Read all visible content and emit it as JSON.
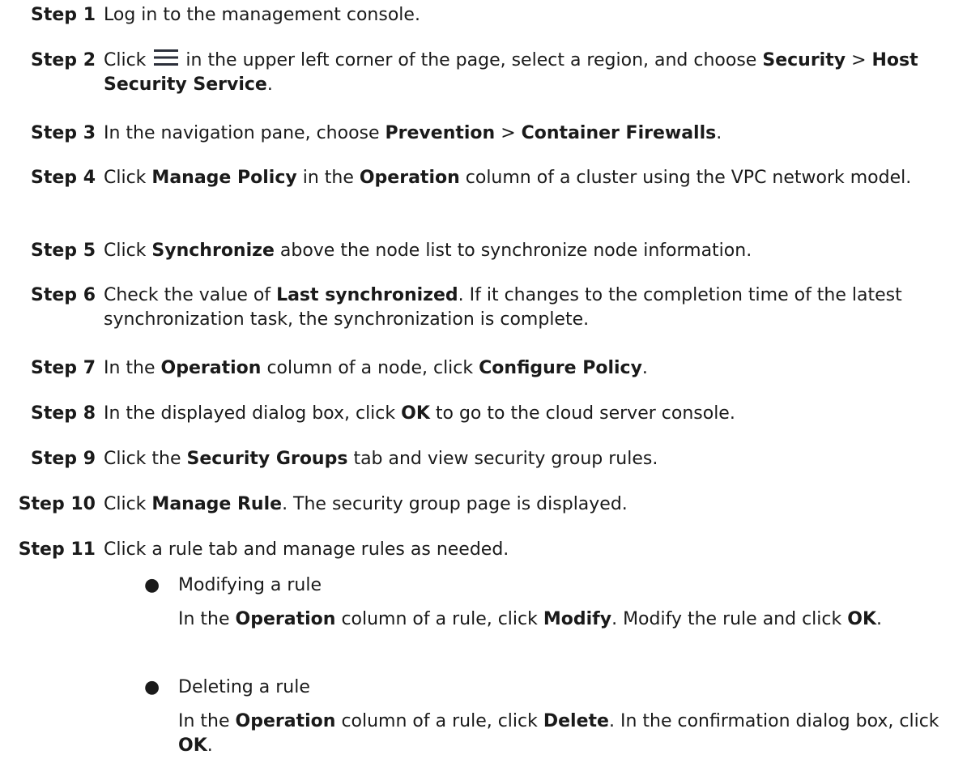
{
  "steps": {
    "s1": {
      "label": "Step 1",
      "text": "Log in to the management console."
    },
    "s2": {
      "label": "Step 2",
      "t1": "Click",
      "t2": "in the upper left corner of the page, select a region, and choose",
      "b1": "Security",
      "t3": ">",
      "b2": "Host Security Service",
      "t4": "."
    },
    "s3": {
      "label": "Step 3",
      "t1": "In the navigation pane, choose",
      "b1": "Prevention",
      "t2": ">",
      "b2": "Container Firewalls",
      "t3": "."
    },
    "s4": {
      "label": "Step 4",
      "t1": "Click",
      "b1": "Manage Policy",
      "t2": "in the",
      "b2": "Operation",
      "t3": "column of a cluster using the VPC network model."
    },
    "s5": {
      "label": "Step 5",
      "t1": "Click",
      "b1": "Synchronize",
      "t2": "above the node list to synchronize node information."
    },
    "s6": {
      "label": "Step 6",
      "t1": "Check the value of",
      "b1": "Last synchronized",
      "t2": ". If it changes to the completion time of the latest synchronization task, the synchronization is complete."
    },
    "s7": {
      "label": "Step 7",
      "t1": "In the",
      "b1": "Operation",
      "t2": "column of a node, click",
      "b2": "Configure Policy",
      "t3": "."
    },
    "s8": {
      "label": "Step 8",
      "t1": "In the displayed dialog box, click",
      "b1": "OK",
      "t2": "to go to the cloud server console."
    },
    "s9": {
      "label": "Step 9",
      "t1": "Click the",
      "b1": "Security Groups",
      "t2": "tab and view security group rules."
    },
    "s10": {
      "label": "Step 10",
      "t1": "Click",
      "b1": "Manage Rule",
      "t2": ". The security group page is displayed."
    },
    "s11": {
      "label": "Step 11",
      "text": "Click a rule tab and manage rules as needed."
    }
  },
  "bullets": {
    "modify": {
      "dot": "●",
      "title": "Modifying a rule",
      "t1": "In the",
      "b1": "Operation",
      "t2": "column of a rule, click",
      "b2": "Modify",
      "t3": ". Modify the rule and click",
      "b3": "OK",
      "t4": "."
    },
    "delete": {
      "dot": "●",
      "title": "Deleting a rule",
      "t1": "In the",
      "b1": "Operation",
      "t2": "column of a rule, click",
      "b2": "Delete",
      "t3": ". In the confirmation dialog box, click",
      "b3": "OK",
      "t4": "."
    }
  },
  "icons": {
    "menu": "hamburger-menu-icon"
  }
}
